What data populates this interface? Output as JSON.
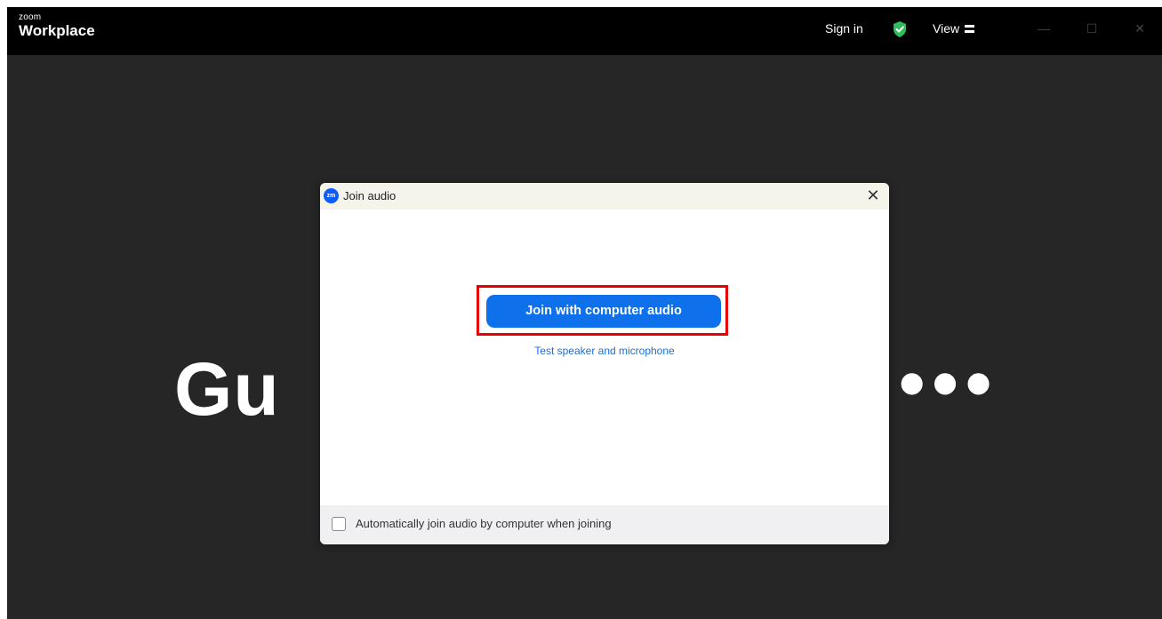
{
  "titlebar": {
    "brand_small": "zoom",
    "brand_large": "Workplace",
    "signin_label": "Sign in",
    "view_label": "View"
  },
  "background": {
    "text_left": "Gu",
    "text_right": "•••"
  },
  "dialog": {
    "title": "Join audio",
    "logo_text": "zm",
    "close_glyph": "✕",
    "join_button_label": "Join with computer audio",
    "test_link_label": "Test speaker and microphone",
    "auto_join_label": "Automatically join audio by computer when joining",
    "auto_join_checked": false
  },
  "window_controls": {
    "minimize": "—",
    "maximize": "☐",
    "close": "✕"
  },
  "colors": {
    "accent_blue": "#0e71eb",
    "highlight_red": "#e60000",
    "shield_green": "#2ebd59"
  },
  "icons": {
    "shield": "shield-check-icon",
    "view": "view-layout-icon",
    "logo": "zoom-logo-icon"
  }
}
